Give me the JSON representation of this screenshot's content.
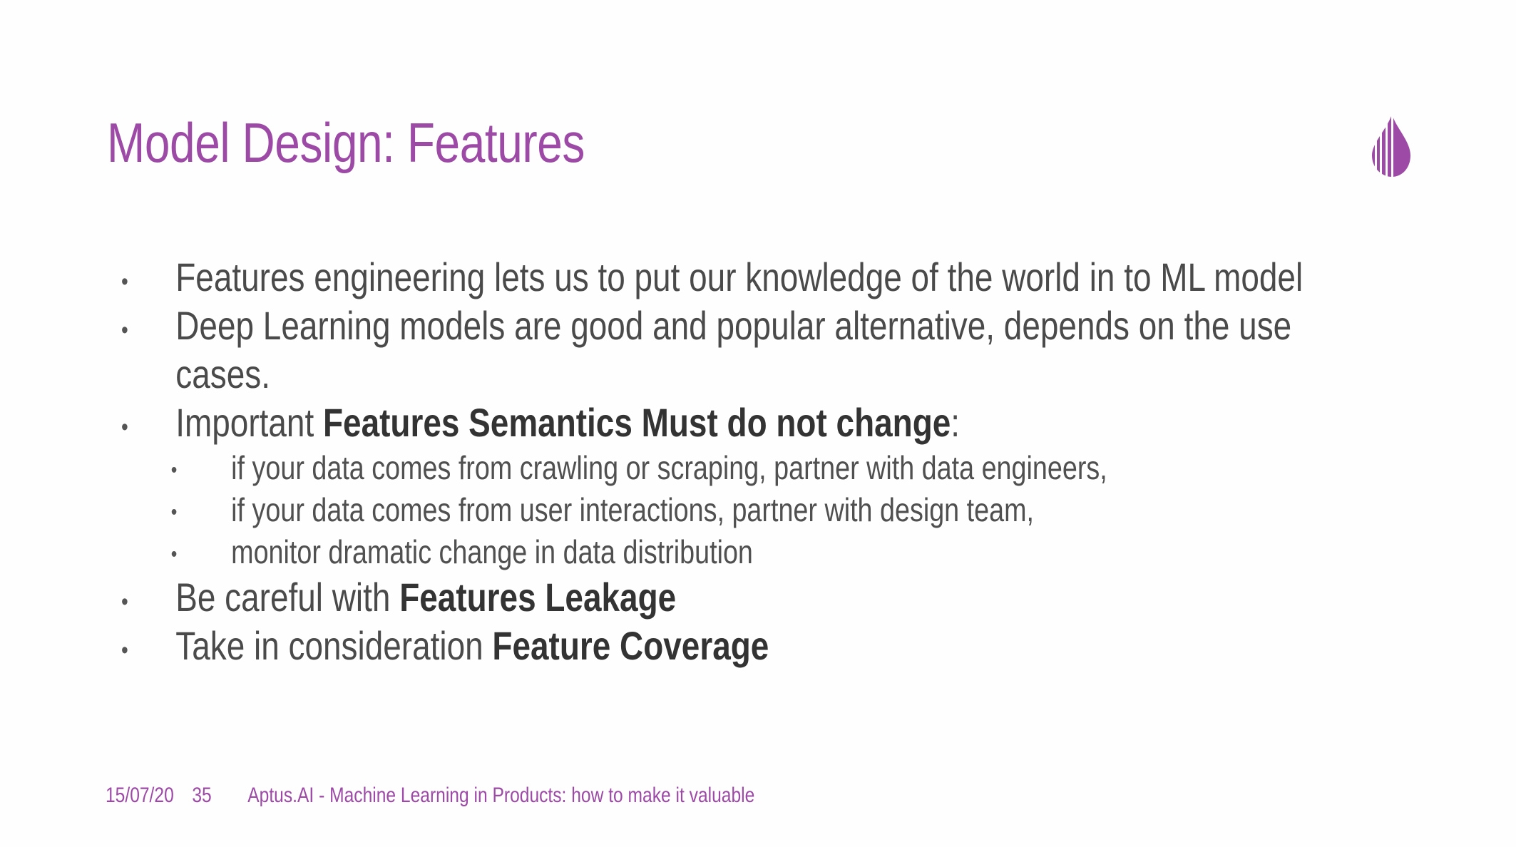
{
  "slide": {
    "title": "Model Design: Features",
    "logo_icon": "drop-logo-icon",
    "accent_color": "#9c4aa6",
    "bullets": [
      {
        "text": "Features engineering lets us to put our knowledge of the world in to ML model"
      },
      {
        "line1": "Deep Learning models are good and popular alternative, depends on the use",
        "line2": "cases."
      },
      {
        "prefix": "Important ",
        "bold": "Features Semantics Must do not change",
        "suffix": ":",
        "sub_bullets": [
          "if your data comes from crawling or scraping, partner with data engineers,",
          "if your data comes from user interactions, partner with design team,",
          "monitor dramatic change in data distribution"
        ]
      },
      {
        "prefix": "Be careful with ",
        "bold": "Features Leakage"
      },
      {
        "prefix": "Take in consideration ",
        "bold": "Feature Coverage"
      }
    ],
    "bullet_glyph": "•"
  },
  "footer": {
    "date": "15/07/20",
    "page_number": "35",
    "text": "Aptus.AI - Machine Learning in Products: how to make it valuable"
  }
}
